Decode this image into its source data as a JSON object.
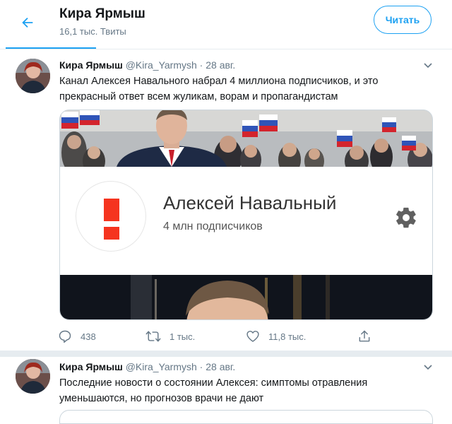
{
  "header": {
    "title": "Кира Ярмыш",
    "tweet_count": "16,1 тыс. Твиты",
    "follow_label": "Читать",
    "back_icon": "arrow-left-icon"
  },
  "colors": {
    "accent": "#1da1f2",
    "text": "#14171a",
    "muted": "#657786",
    "border": "#e6ecf0",
    "youtube_red": "#f5341f"
  },
  "tweets": [
    {
      "name": "Кира Ярмыш",
      "handle": "@Kira_Yarmysh",
      "dot": "·",
      "date": "28 авг.",
      "text": "Канал Алексея Навального набрал 4 миллиона подписчиков, и это прекрасный ответ всем жуликам, ворам и пропагандистам",
      "card": {
        "channel_name": "Алексей Навальный",
        "subscribers": "4 млн подписчиков"
      },
      "actions": {
        "replies": "438",
        "retweets": "1 тыс.",
        "likes": "11,8 тыс."
      }
    },
    {
      "name": "Кира Ярмыш",
      "handle": "@Kira_Yarmysh",
      "dot": "·",
      "date": "28 авг.",
      "text": "Последние новости о состоянии Алексея: симптомы отравления уменьшаются, но прогнозов врачи не дают"
    }
  ]
}
